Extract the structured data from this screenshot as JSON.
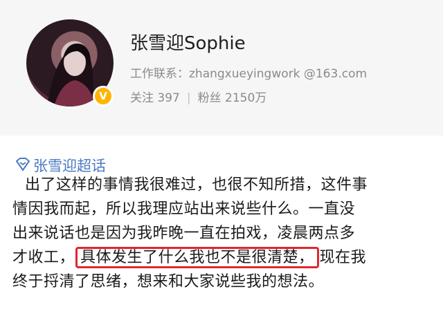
{
  "profile": {
    "name": "张雪迎Sophie",
    "contact": "工作联系：zhangxueyingwork @163.com",
    "following_label": "关注 397",
    "followers_label": "粉丝 2150万",
    "separator": "|",
    "badge_glyph": "V"
  },
  "topic": {
    "label": "张雪迎超话",
    "icon": "diamond-topic-icon",
    "color": "#4a79c4"
  },
  "post": {
    "line1": "出了这样的事情我很难过，也很不知所措，这件事",
    "line2": "情因我而起，所以我理应站出来说些什么。一直没",
    "line3": "出来说话也是因为我昨晚一直在拍戏，凌晨两点多",
    "line4_before": "才收工，",
    "line4_highlight": "具体发生了什么我也不是很清楚，",
    "line4_after": "现在我",
    "line5": "终于捋清了思绪，想来和大家说些我的想法。",
    "highlight_color": "#e0262e"
  }
}
